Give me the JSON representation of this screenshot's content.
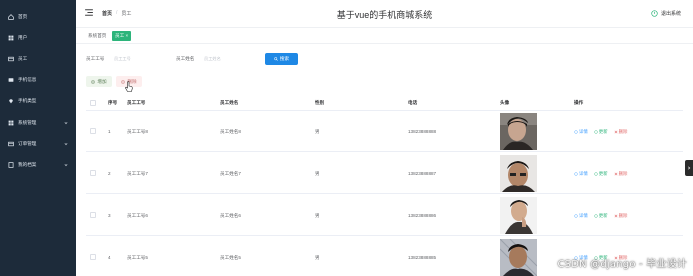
{
  "sidebar": {
    "items": [
      {
        "label": "首页",
        "icon": "home-icon"
      },
      {
        "label": "用户",
        "icon": "grid-icon"
      },
      {
        "label": "员工",
        "icon": "card-icon"
      },
      {
        "label": "手机信息",
        "icon": "phone-icon"
      },
      {
        "label": "手机类型",
        "icon": "location-icon"
      },
      {
        "label": "系统管理",
        "icon": "grid-icon",
        "expandable": true
      },
      {
        "label": "订单管理",
        "icon": "card-icon",
        "expandable": true
      },
      {
        "label": "我的档案",
        "icon": "doc-icon",
        "expandable": true
      }
    ]
  },
  "header": {
    "breadcrumb_home": "首页",
    "breadcrumb_sep": "/",
    "breadcrumb_current": "员工",
    "title": "基于vue的手机商城系统",
    "logout": "退出系统"
  },
  "tags": {
    "home": "系统首页",
    "current": "员工 ×"
  },
  "search": {
    "field1_label": "员工工号",
    "field1_placeholder": "员工工号",
    "field2_label": "员工姓名",
    "field2_placeholder": "员工姓名",
    "button": "搜索"
  },
  "actions": {
    "add": "增加",
    "delete": "删除"
  },
  "table": {
    "columns": [
      "序号",
      "员工工号",
      "员工姓名",
      "性别",
      "电话",
      "头像",
      "操作"
    ],
    "rows": [
      {
        "index": "1",
        "emp_no": "员工工号8",
        "name": "员工姓名8",
        "gender": "男",
        "phone": "13823888888"
      },
      {
        "index": "2",
        "emp_no": "员工工号7",
        "name": "员工姓名7",
        "gender": "男",
        "phone": "13823888887"
      },
      {
        "index": "3",
        "emp_no": "员工工号6",
        "name": "员工姓名6",
        "gender": "男",
        "phone": "13823888886"
      },
      {
        "index": "4",
        "emp_no": "员工工号5",
        "name": "员工姓名5",
        "gender": "男",
        "phone": "13823888885"
      }
    ],
    "ops": {
      "detail": "详情",
      "edit": "更新",
      "remove": "删除"
    }
  },
  "watermark": "CSDN @django - 毕业设计",
  "colors": {
    "sidebar_bg": "#1d2b3a",
    "primary": "#1e88e5",
    "tag_green": "#2db47b",
    "danger": "#e06666"
  }
}
